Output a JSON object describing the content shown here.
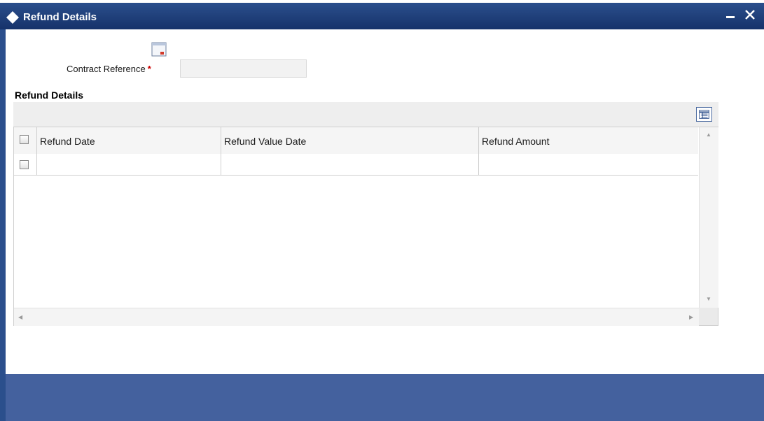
{
  "window": {
    "title": "Refund Details",
    "icons": {
      "title": "diamond-icon",
      "minimize": "minimize-icon",
      "close": "close-icon"
    }
  },
  "form": {
    "launcher_icon": "lov-launch-icon",
    "contract_reference": {
      "label": "Contract Reference",
      "required_marker": "*",
      "value": ""
    }
  },
  "section": {
    "title": "Refund Details"
  },
  "grid": {
    "toolbar_icon": "grid-view-icon",
    "columns": [
      "Refund Date",
      "Refund Value Date",
      "Refund Amount"
    ],
    "rows": [
      {
        "refund_date": "",
        "refund_value_date": "",
        "refund_amount": ""
      }
    ]
  },
  "colors": {
    "titlebar": "#16326a",
    "footer": "#44619e",
    "required": "#cc0000"
  }
}
